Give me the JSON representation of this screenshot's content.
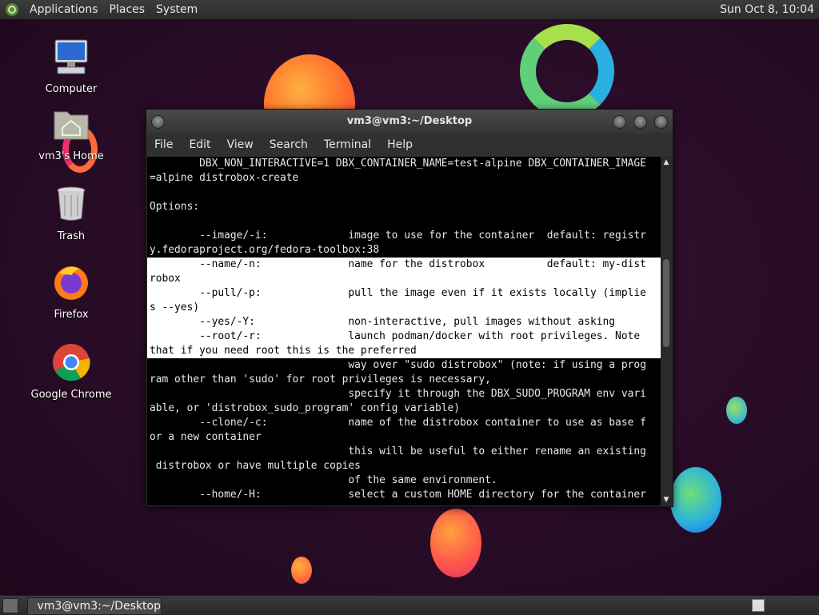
{
  "top_panel": {
    "menus": [
      "Applications",
      "Places",
      "System"
    ],
    "clock": "Sun Oct 8, 10:04"
  },
  "desktop_icons": [
    {
      "label": "Computer",
      "icon": "computer-icon"
    },
    {
      "label": "vm3's Home",
      "icon": "home-folder-icon"
    },
    {
      "label": "Trash",
      "icon": "trash-icon"
    },
    {
      "label": "Firefox",
      "icon": "firefox-icon"
    },
    {
      "label": "Google Chrome",
      "icon": "chrome-icon"
    }
  ],
  "window": {
    "title": "vm3@vm3:~/Desktop",
    "menu": [
      "File",
      "Edit",
      "View",
      "Search",
      "Terminal",
      "Help"
    ]
  },
  "terminal_lines": [
    "        DBX_NON_INTERACTIVE=1 DBX_CONTAINER_NAME=test-alpine DBX_CONTAINER_IMAGE",
    "=alpine distrobox-create",
    "",
    "Options:",
    "",
    "        --image/-i:             image to use for the container  default: registr",
    "y.fedoraproject.org/fedora-toolbox:38",
    "        --name/-n:              name for the distrobox          default: my-dist",
    "robox",
    "        --pull/-p:              pull the image even if it exists locally (implie",
    "s --yes)",
    "        --yes/-Y:               non-interactive, pull images without asking",
    "        --root/-r:              launch podman/docker with root privileges. Note ",
    "that if you need root this is the preferred",
    "                                way over \"sudo distrobox\" (note: if using a prog",
    "ram other than 'sudo' for root privileges is necessary,",
    "                                specify it through the DBX_SUDO_PROGRAM env vari",
    "able, or 'distrobox_sudo_program' config variable)",
    "        --clone/-c:             name of the distrobox container to use as base f",
    "or a new container",
    "                                this will be useful to either rename an existing",
    " distrobox or have multiple copies",
    "                                of the same environment.",
    "        --home/-H:              select a custom HOME directory for the container"
  ],
  "selected_rows": [
    7,
    8,
    9,
    10,
    11,
    12,
    13
  ],
  "taskbar": {
    "task_label": "vm3@vm3:~/Desktop"
  },
  "colors": {
    "terminal_bg": "#000000",
    "terminal_fg": "#e8e8e8",
    "selection_bg": "#ffffff",
    "selection_fg": "#000000"
  }
}
